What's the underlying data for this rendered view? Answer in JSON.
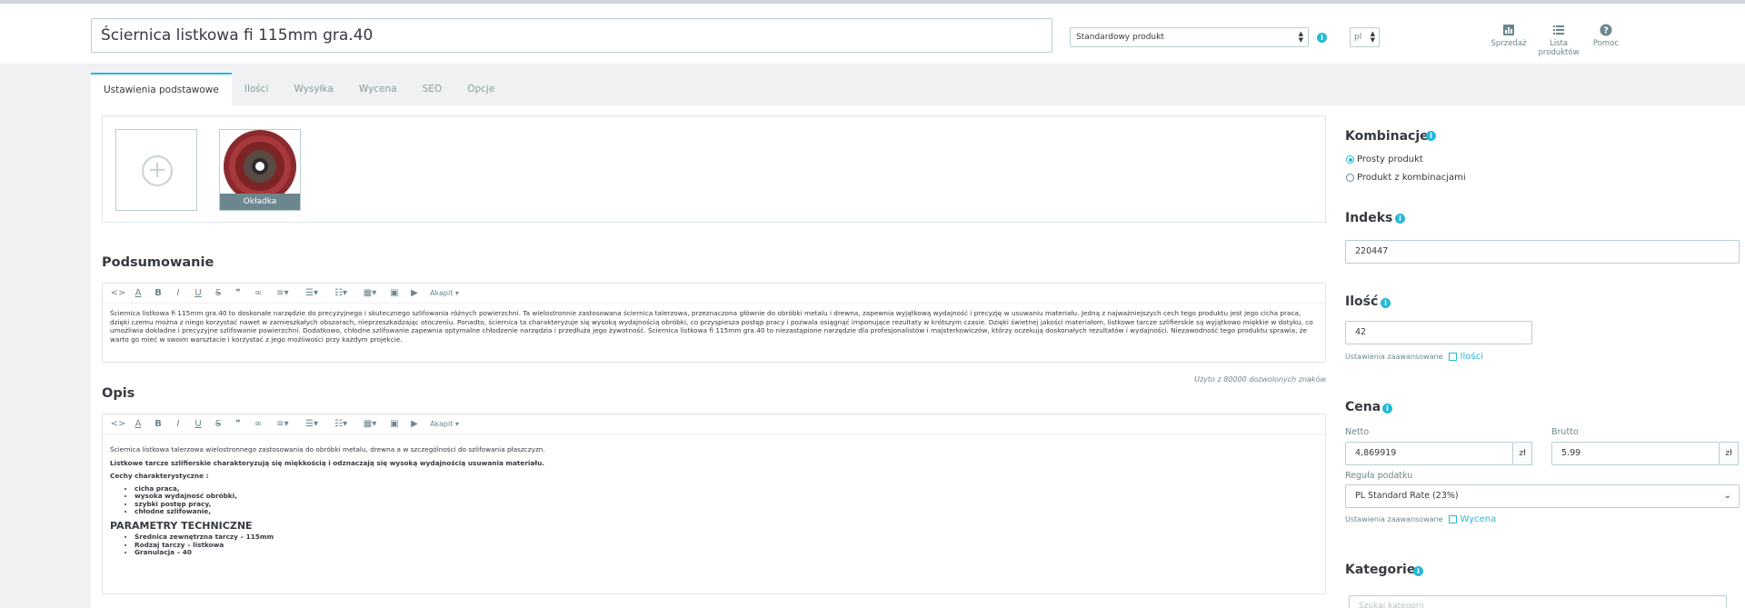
{
  "header": {
    "product_name": "Ściernica listkowa fi 115mm gra.40",
    "product_type": "Standardowy produkt",
    "language": "pl",
    "links": [
      {
        "label": "Sprzedaż",
        "icon": "bar-chart-icon"
      },
      {
        "label": "Lista produktów",
        "icon": "list-icon"
      },
      {
        "label": "Pomoc",
        "icon": "help-icon"
      }
    ]
  },
  "tabs": [
    {
      "label": "Ustawienia podstawowe",
      "active": true
    },
    {
      "label": "Ilości"
    },
    {
      "label": "Wysyłka"
    },
    {
      "label": "Wycena"
    },
    {
      "label": "SEO"
    },
    {
      "label": "Opcje"
    }
  ],
  "images": {
    "cover_label": "Okładka"
  },
  "summary": {
    "title": "Podsumowanie",
    "text": "Ściernica listkowa fi 115mm gra.40 to doskonałe narzędzie do precyzyjnego i skutecznego szlifowania różnych powierzchni. Ta wielostronnie zastosowana ściernica talerzowa, przeznaczona głównie do obróbki metalu i drewna, zapewnia wyjątkową wydajność i precyzję w usuwaniu materiału. Jedną z najważniejszych cech tego produktu jest jego cicha praca, dzięki czemu można z niego korzystać nawet w zamieszkałych obszarach, nieprzeszkadzając otoczeniu. Ponadto, ściernica ta charakteryzuje się wysoką wydajnością obróbki, co przyspiesza postęp pracy i pozwala osiągnąć imponujące rezultaty w krótszym czasie. Dzięki świetnej jakości materiałom, listkowe tarcze szlifierskie są wyjątkowo miękkie w dotyku, co umożliwia dokładne i precyzyjne szlifowanie powierzchni. Dodatkowo, chłodne szlifowanie zapewnia optymalne chłodzenie narzędzia i przedłuża jego żywotność. Ściernica listkowa fi 115mm gra.40 to niezastąpione narzędzie dla profesjonalistów i majsterkowiczów, którzy oczekują doskonałych rezultatów i wydajności. Niezawodność tego produktu sprawia, że warto go mieć w swoim warsztacie i korzystać z jego możliwości przy każdym projekcie.",
    "counter": "Użyto z 80000 dozwolonych znaków"
  },
  "editor": {
    "paragraph_label": "Akapit",
    "toolbar": [
      {
        "name": "code-icon",
        "glyph": "<>"
      },
      {
        "name": "text-color-icon",
        "glyph": "A"
      },
      {
        "name": "bold-icon",
        "glyph": "B"
      },
      {
        "name": "italic-icon",
        "glyph": "I"
      },
      {
        "name": "underline-icon",
        "glyph": "U"
      },
      {
        "name": "strikethrough-icon",
        "glyph": "S"
      },
      {
        "name": "quote-icon",
        "glyph": "❞"
      },
      {
        "name": "link-icon",
        "glyph": "∞"
      }
    ]
  },
  "description": {
    "title": "Opis",
    "intro": "Ściernica listkowa talerzowa wielostronnego zastosowania do obróbki metalu, drewna a w szczególności do szlifowania płaszczyzn.",
    "highlight": "Listkowe tarcze szlifierskie charakteryzują się miękkością i odznaczają się wysoką wydajnością usuwania materiału.",
    "features_title": "Cechy charakterystyczne :",
    "features": [
      "cicha praca,",
      "wysoka wydajność obróbki,",
      "szybki postęp pracy,",
      "chłodne szlifowanie,"
    ],
    "params_title": "PARAMETRY TECHNICZNE",
    "params": [
      "Średnica zewnętrzna tarczy – 115mm",
      "Rodzaj tarczy – listkowa",
      "Granulacja – 40"
    ]
  },
  "right": {
    "combinations_title": "Kombinacje",
    "combinations_options": [
      "Prosty produkt",
      "Produkt z kombinacjami"
    ],
    "index_title": "Indeks",
    "index_value": "220447",
    "qty_title": "Ilość",
    "qty_value": "42",
    "advanced_label": "Ustawienia zaawansowane",
    "qty_link": "Ilości",
    "price_title": "Cena",
    "net_label": "Netto",
    "net_value": "4,869919",
    "gross_label": "Brutto",
    "gross_value": "5.99",
    "currency": "zł",
    "tax_label": "Reguła podatku",
    "tax_value": "PL Standard Rate (23%)",
    "price_link": "Wycena",
    "categories_title": "Kategorie",
    "search_placeholder": "Szukaj kategorii"
  },
  "colors": {
    "accent": "#25b9d7",
    "text": "#363a41",
    "muted": "#6c868e",
    "border": "#bbcdd2"
  }
}
